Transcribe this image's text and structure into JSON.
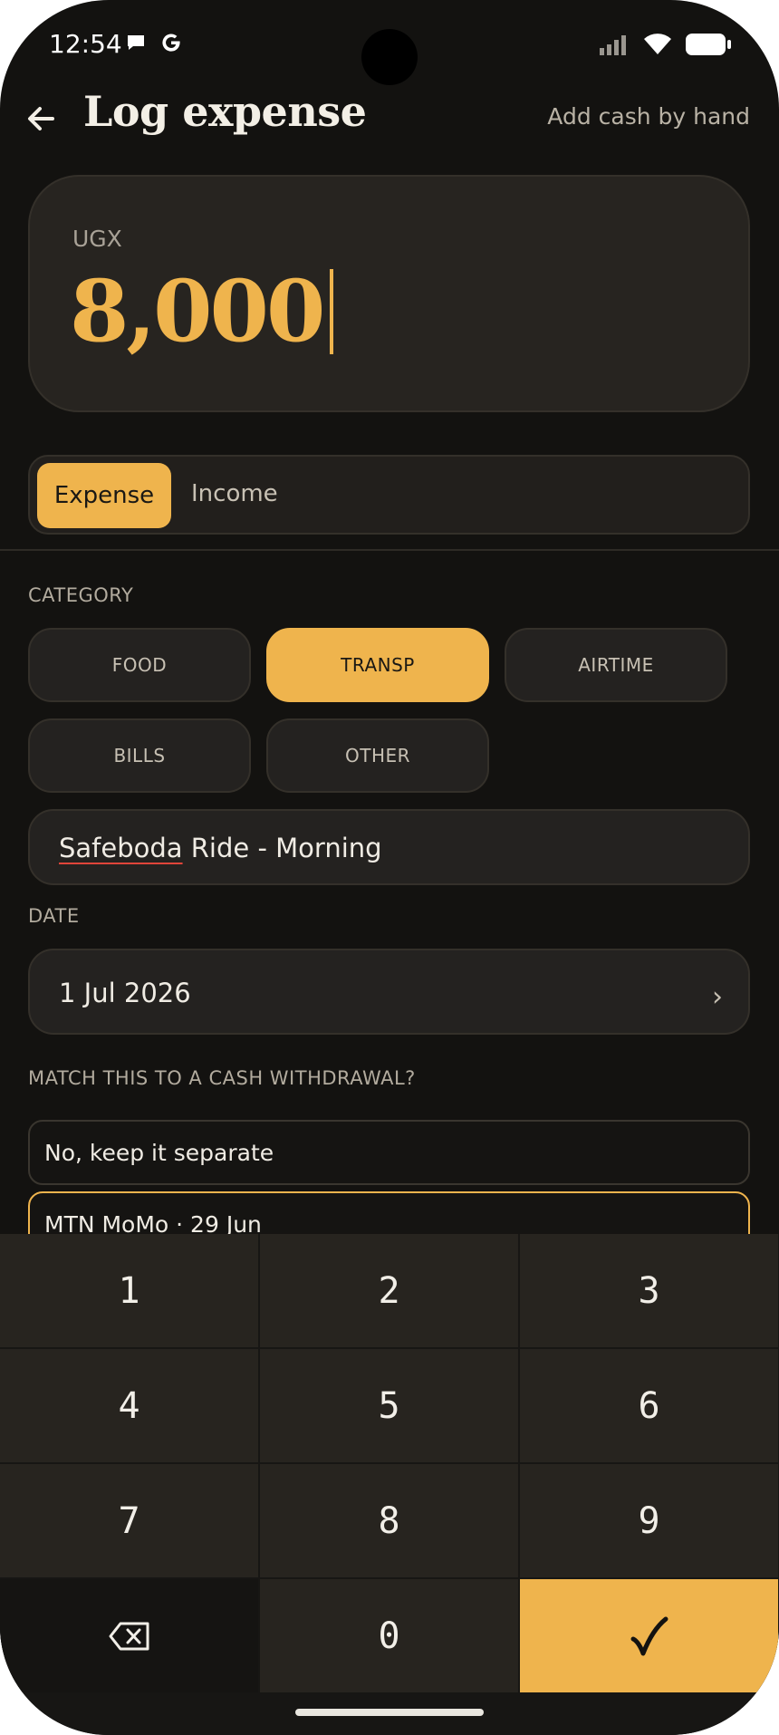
{
  "status_bar": {
    "time": "12:54"
  },
  "header": {
    "title": "Log expense",
    "add_cash": "Add cash by hand"
  },
  "amount": {
    "currency": "UGX",
    "value": "8,000"
  },
  "type_toggle": {
    "expense": "Expense",
    "income": "Income",
    "selected": "Expense"
  },
  "category": {
    "label": "CATEGORY",
    "chips": [
      "FOOD",
      "TRANSP",
      "AIRTIME",
      "BILLS",
      "OTHER"
    ],
    "selected": "TRANSP"
  },
  "note": {
    "misspelled": "Safeboda",
    "rest": " Ride - Morning"
  },
  "date": {
    "label": "DATE",
    "value": "1 Jul 2026",
    "chevron": "›"
  },
  "match": {
    "label": "MATCH THIS TO A CASH WITHDRAWAL?",
    "options": [
      "No, keep it separate",
      "MTN MoMo · 29 Jun"
    ],
    "selected": "MTN MoMo · 29 Jun"
  },
  "keypad": {
    "keys": [
      "1",
      "2",
      "3",
      "4",
      "5",
      "6",
      "7",
      "8",
      "9",
      "⌫",
      "0",
      "✓"
    ]
  },
  "colors": {
    "accent": "#efb44d",
    "background": "#131210",
    "card": "#272420"
  }
}
